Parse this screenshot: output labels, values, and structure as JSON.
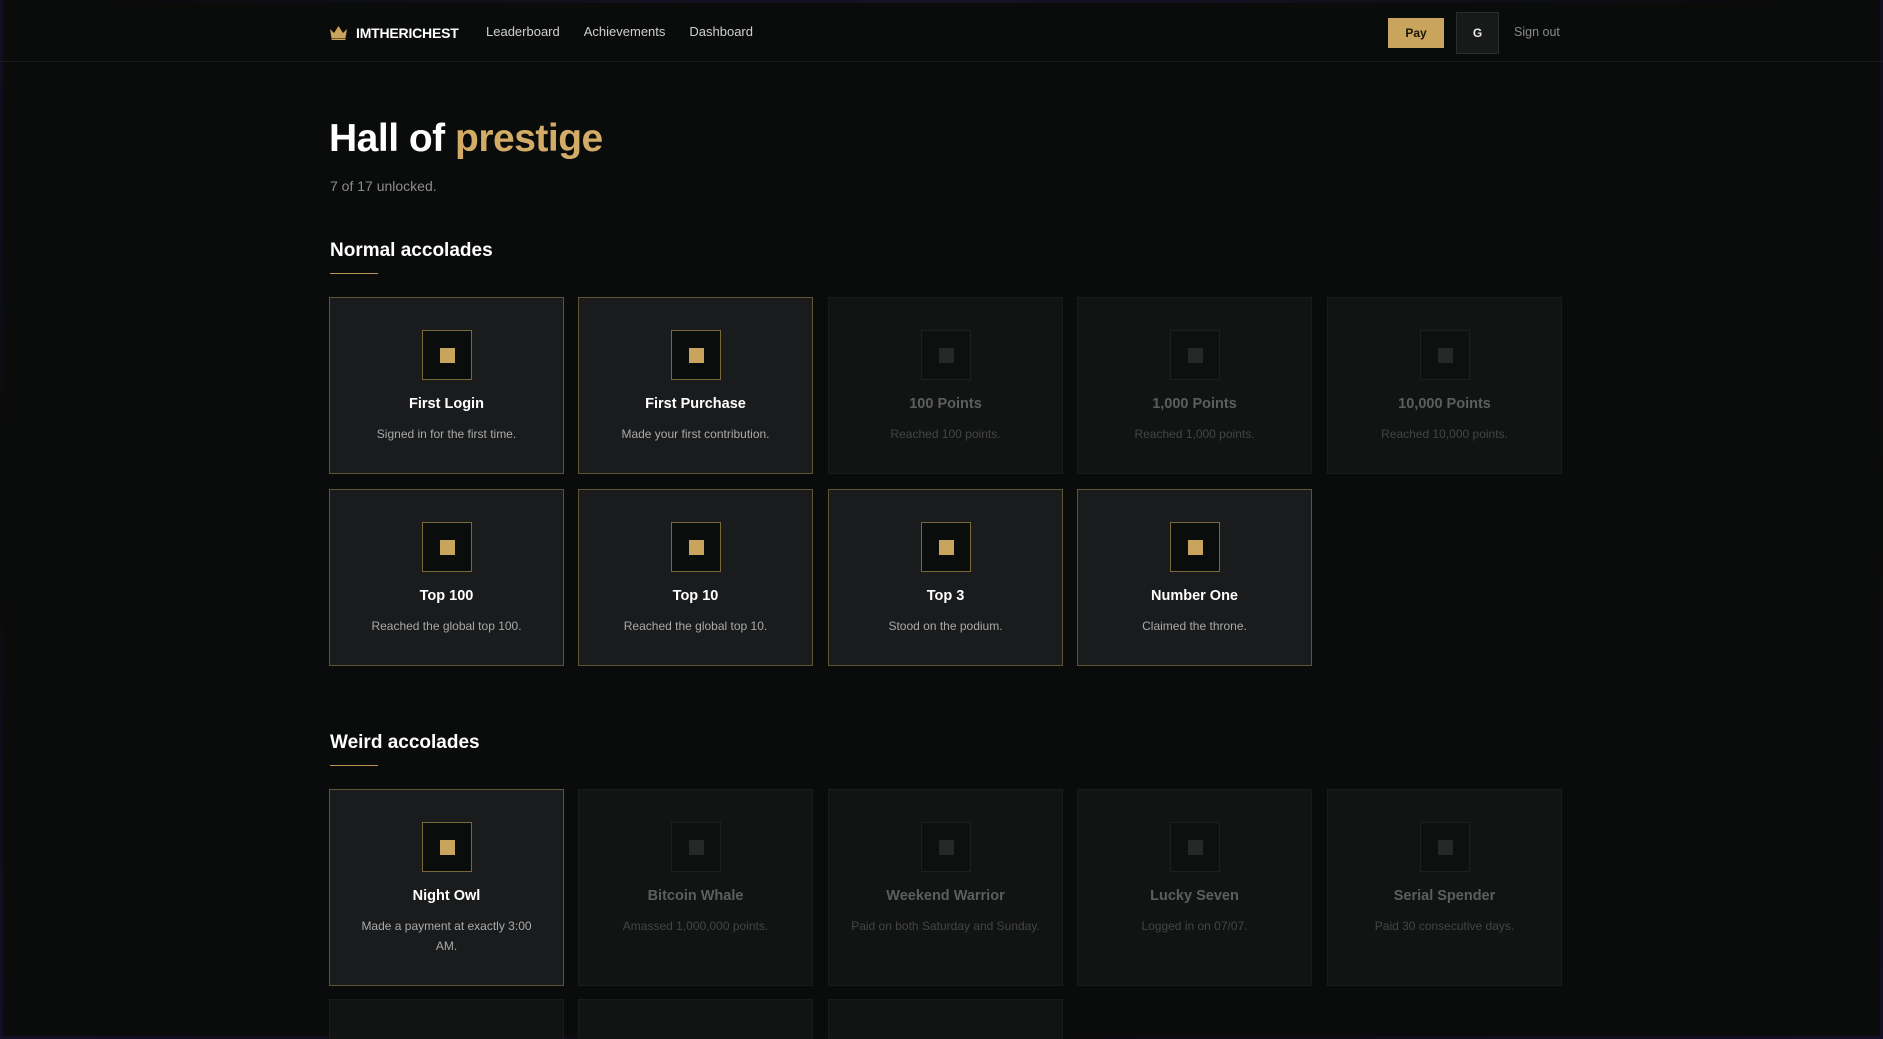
{
  "header": {
    "brand": "IMTHERICHEST",
    "nav": [
      {
        "label": "Leaderboard"
      },
      {
        "label": "Achievements"
      },
      {
        "label": "Dashboard"
      }
    ],
    "pay_label": "Pay",
    "avatar_initial": "G",
    "signout_label": "Sign out"
  },
  "page": {
    "title_prefix": "Hall of ",
    "title_accent": "prestige",
    "summary": "7 of 17 unlocked."
  },
  "colors": {
    "accent": "#c9a45c",
    "background": "#0a0b0b",
    "card_unlocked": "#1a1b1c",
    "card_locked": "#121313"
  },
  "sections": [
    {
      "title": "Normal accolades",
      "cards": [
        {
          "title": "First Login",
          "desc": "Signed in for the first time.",
          "unlocked": true
        },
        {
          "title": "First Purchase",
          "desc": "Made your first contribution.",
          "unlocked": true
        },
        {
          "title": "100 Points",
          "desc": "Reached 100 points.",
          "unlocked": false
        },
        {
          "title": "1,000 Points",
          "desc": "Reached 1,000 points.",
          "unlocked": false
        },
        {
          "title": "10,000 Points",
          "desc": "Reached 10,000 points.",
          "unlocked": false
        },
        {
          "title": "Top 100",
          "desc": "Reached the global top 100.",
          "unlocked": true
        },
        {
          "title": "Top 10",
          "desc": "Reached the global top 10.",
          "unlocked": true
        },
        {
          "title": "Top 3",
          "desc": "Stood on the podium.",
          "unlocked": true
        },
        {
          "title": "Number One",
          "desc": "Claimed the throne.",
          "unlocked": true
        }
      ]
    },
    {
      "title": "Weird accolades",
      "cards": [
        {
          "title": "Night Owl",
          "desc": "Made a payment at exactly 3:00 AM.",
          "unlocked": true
        },
        {
          "title": "Bitcoin Whale",
          "desc": "Amassed 1,000,000 points.",
          "unlocked": false
        },
        {
          "title": "Weekend Warrior",
          "desc": "Paid on both Saturday and Sunday.",
          "unlocked": false
        },
        {
          "title": "Lucky Seven",
          "desc": "Logged in on 07/07.",
          "unlocked": false
        },
        {
          "title": "Serial Spender",
          "desc": "Paid 30 consecutive days.",
          "unlocked": false
        }
      ]
    }
  ]
}
